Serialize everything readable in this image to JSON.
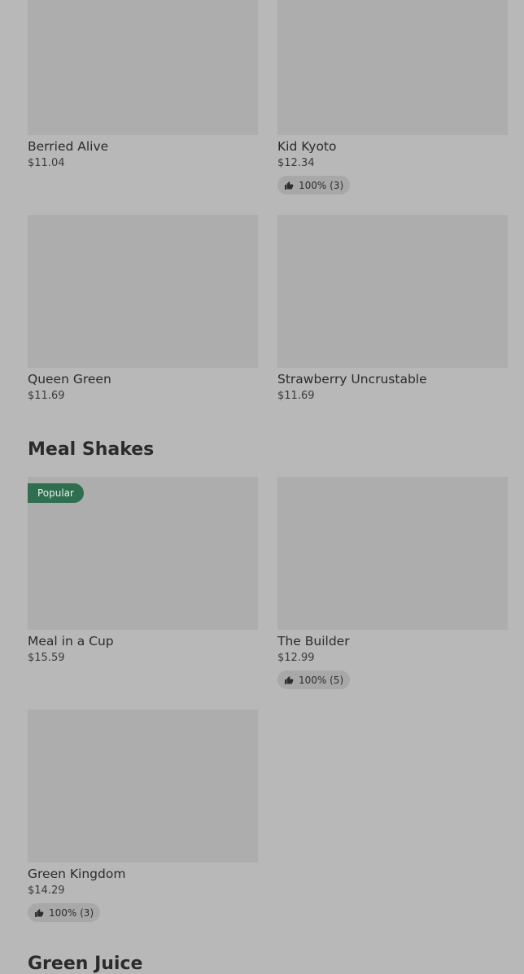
{
  "rows": {
    "top": [
      {
        "name": "Berried Alive",
        "price": "$11.04"
      },
      {
        "name": "Kid Kyoto",
        "price": "$12.34",
        "rating": "100% (3)"
      }
    ],
    "second": [
      {
        "name": "Queen Green",
        "price": "$11.69"
      },
      {
        "name": "Strawberry Uncrustable",
        "price": "$11.69"
      }
    ]
  },
  "sections": {
    "meal_shakes": {
      "title": "Meal Shakes",
      "items": [
        {
          "name": "Meal in a Cup",
          "price": "$15.59",
          "badge": "Popular"
        },
        {
          "name": "The Builder",
          "price": "$12.99",
          "rating": "100% (5)"
        },
        {
          "name": "Green Kingdom",
          "price": "$14.29",
          "rating": "100% (3)"
        }
      ]
    },
    "green_juice": {
      "title": "Green Juice"
    }
  },
  "colors": {
    "background": "#b8b8b8",
    "thumbnail": "#adadad",
    "badge": "#2f6e4e"
  },
  "icons": {
    "rating": "thumbs-up-icon"
  }
}
